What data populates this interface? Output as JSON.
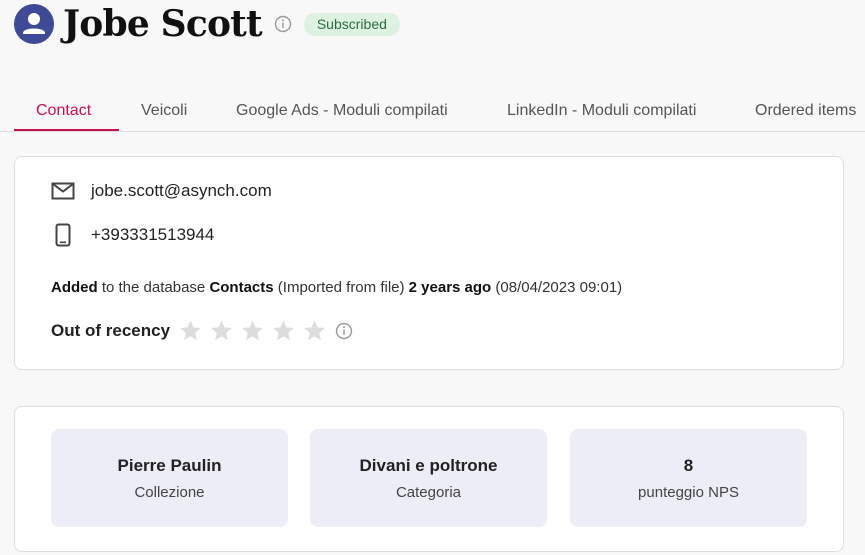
{
  "header": {
    "name": "Jobe Scott",
    "badge": "Subscribed",
    "icons": [
      "user-avatar-icon",
      "info-icon"
    ]
  },
  "tabs": [
    {
      "label": "Contact",
      "active": true
    },
    {
      "label": "Veicoli",
      "active": false
    },
    {
      "label": "Google Ads - Moduli compilati",
      "active": false
    },
    {
      "label": "LinkedIn - Moduli compilati",
      "active": false
    },
    {
      "label": "Ordered items",
      "active": false
    }
  ],
  "contact": {
    "email": "jobe.scott@asynch.com",
    "phone": "+393331513944",
    "added": {
      "verb": "Added",
      "mid1": " to the database ",
      "database": "Contacts",
      "mid2": " (Imported from file) ",
      "ago": "2 years ago",
      "date": " (08/04/2023 09:01)"
    },
    "recency": {
      "label": "Out of recency",
      "rating": 0,
      "max": 5
    }
  },
  "stats": [
    {
      "value": "Pierre Paulin",
      "label": "Collezione"
    },
    {
      "value": "Divani e poltrone",
      "label": "Categoria"
    },
    {
      "value": "8",
      "label": "punteggio NPS"
    }
  ],
  "colors": {
    "accent": "#c8124f",
    "avatar": "#3f4a97",
    "badge_bg": "#def2e2",
    "badge_text": "#2e6b3f",
    "stat_bg": "#ecedf6",
    "star_empty": "#dcdcdc"
  }
}
